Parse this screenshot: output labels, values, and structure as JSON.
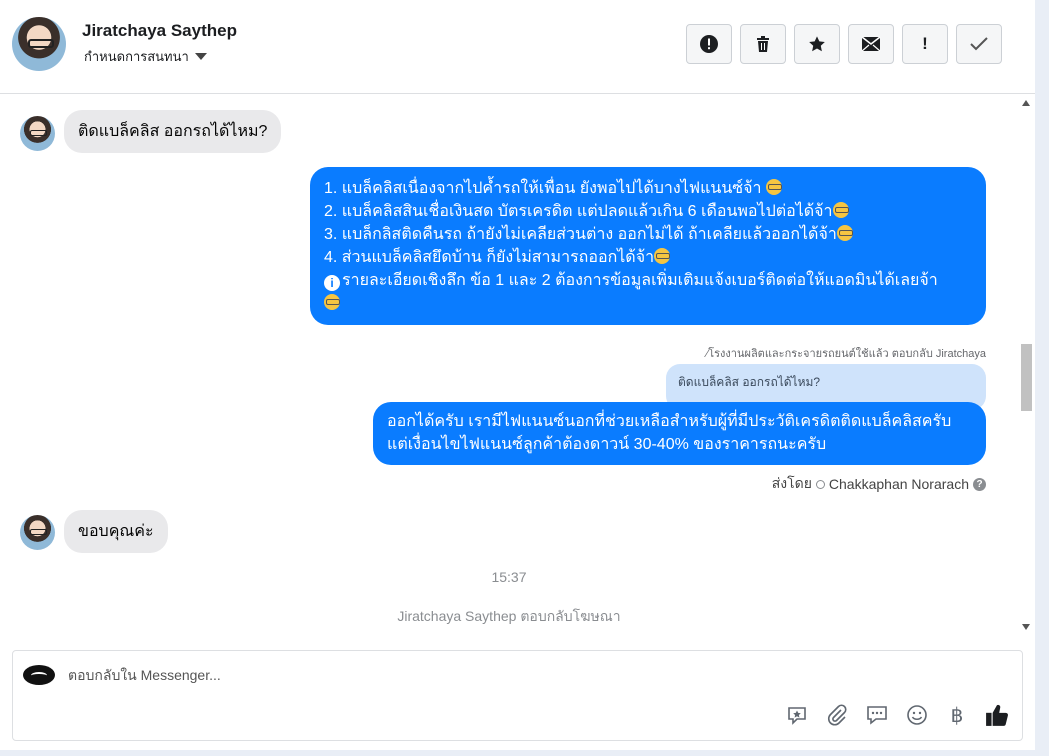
{
  "header": {
    "name": "Jiratchaya Saythep",
    "subtitle": "กำหนดการสนทนา",
    "toolbar": [
      {
        "icon": "alert-circle-icon",
        "glyph": "!"
      },
      {
        "icon": "trash-icon",
        "glyph": ""
      },
      {
        "icon": "star-icon",
        "glyph": "★"
      },
      {
        "icon": "mail-icon",
        "glyph": ""
      },
      {
        "icon": "exclamation-icon",
        "glyph": "!"
      },
      {
        "icon": "check-icon",
        "glyph": "✓"
      }
    ]
  },
  "messages": {
    "first_in": "ติดแบล็คลิส ออกรถได้ไหม?",
    "reply_lines": [
      "1. แบล็คลิสเนื่องจากไปค้ำรถให้เพื่อน ยังพอไปได้บางไฟแนนซ์จ้า ",
      "2. แบล็คลิสสินเชื่อเงินสด บัตรเครดิต แต่ปลดแล้วเกิน 6 เดือนพอไปต่อได้จ้า",
      "3. แบล็กลิสติดคืนรถ ถ้ายังไม่เคลียส่วนต่าง ออกไม่ได้ ถ้าเคลียแล้วออกได้จ้า",
      "4. ส่วนแบล็คลิสยึดบ้าน ก็ยังไม่สามารถออกได้จ้า",
      "รายละเอียดเชิงลึก ข้อ 1 และ 2 ต้องการข้อมูลเพิ่มเติมแจ้งเบอร์ติดต่อให้แอดมินได้เลยจ้า"
    ],
    "reply_meta": "⁄โรงงานผลิตและกระจายรถยนต์ใช้แล้ว ตอบกลับ Jiratchaya",
    "quote": "ติดแบล็คลิส ออกรถได้ไหม?",
    "answer_lines": [
      "ออกได้ครับ เรามีไฟแนนซ์นอกที่ช่วยเหลือสำหรับผู้ที่มีประวัติเครดิตติดแบล็คลิสครับ",
      "แต่เงื่อนไขไฟแนนซ์ลูกค้าต้องดาวน์ 30-40% ของราคารถนะครับ"
    ],
    "sent_by_label": "ส่งโดย",
    "sent_by_name": "Chakkaphan Norarach",
    "thanks": "ขอบคุณค่ะ",
    "time": "15:37",
    "ad_reply": "Jiratchaya Saythep ตอบกลับโฆษณา"
  },
  "composer": {
    "placeholder": "ตอบกลับใน Messenger...",
    "tools": [
      "sticker-icon",
      "attachment-icon",
      "saved-reply-icon",
      "emoji-icon",
      "baht-icon",
      "like-icon"
    ]
  },
  "colors": {
    "outgoing": "#0a7cff",
    "incoming": "#e9e9eb",
    "quote": "#cfe3fb"
  }
}
